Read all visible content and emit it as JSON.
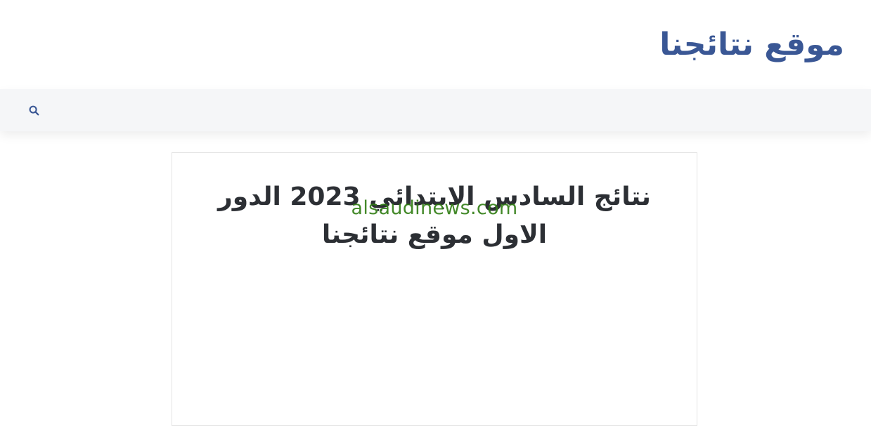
{
  "header": {
    "site_title": "موقع نتائجنا"
  },
  "navbar": {
    "search_icon": "search-icon"
  },
  "article": {
    "title": "نتائج السادس الابتدائي 2023 الدور الاول موقع نتائجنا",
    "watermark": "alsaudinews.com"
  },
  "colors": {
    "brand": "#3a5795",
    "title_text": "#2c2f34",
    "watermark": "#2f7d12",
    "navbar_bg": "#f5f6f8"
  }
}
